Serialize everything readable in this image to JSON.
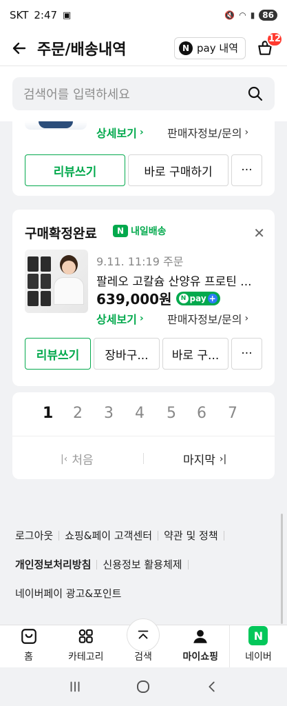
{
  "status_bar": {
    "carrier": "SKT",
    "time": "2:47",
    "battery": "86"
  },
  "header": {
    "title": "주문/배송내역",
    "npay_label": "pay 내역",
    "npay_icon_text": "N",
    "cart_count": "12"
  },
  "search": {
    "placeholder": "검색어를 입력하세요"
  },
  "order_card_1": {
    "detail_link": "상세보기",
    "seller_link": "판매자정보/문의",
    "buttons": {
      "review": "리뷰쓰기",
      "buy_now": "바로 구매하기",
      "more": "···"
    }
  },
  "order_card_2": {
    "status": "구매확정완료",
    "delivery_badge": "내일배송",
    "date": "9.11. 11:19 주문",
    "product_name": "팔레오 고칼슘 산양유 프로틴 ...",
    "price": "639,000원",
    "npay_badge": "pay",
    "detail_link": "상세보기",
    "seller_link": "판매자정보/문의",
    "buttons": {
      "review": "리뷰쓰기",
      "cart": "장바구...",
      "buy_now": "바로 구...",
      "more": "···"
    }
  },
  "pagination": {
    "pages": [
      "1",
      "2",
      "3",
      "4",
      "5",
      "6",
      "7"
    ],
    "active_page": "1",
    "first_label": "처음",
    "last_label": "마지막"
  },
  "footer": {
    "row1": [
      "로그아웃",
      "쇼핑&페이 고객센터",
      "약관 및 정책"
    ],
    "row2": [
      "개인정보처리방침",
      "신용정보 활용체제"
    ],
    "row3": [
      "네이버페이 광고&포인트"
    ]
  },
  "bottom_nav": {
    "home": "홈",
    "category": "카테고리",
    "search": "검색",
    "myshopping": "마이쇼핑",
    "naver": "네이버"
  },
  "colors": {
    "accent": "#03a94d",
    "badge": "#ff3b30"
  }
}
